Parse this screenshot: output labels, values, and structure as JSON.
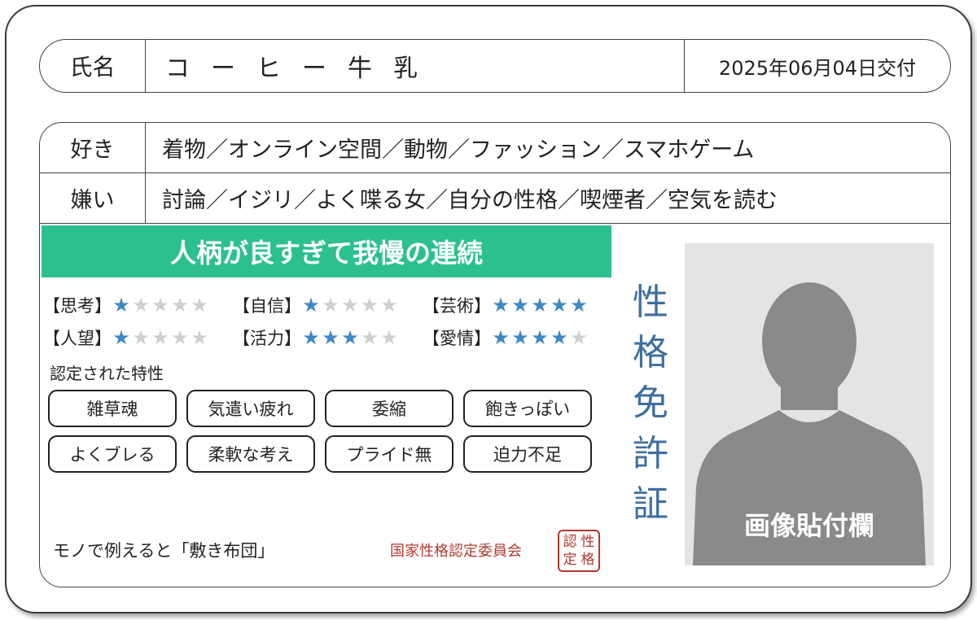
{
  "name_row": {
    "label": "氏名",
    "name": "コーヒー牛乳",
    "issued": "2025年06月04日交付"
  },
  "likes": {
    "label": "好き",
    "value": "着物／オンライン空間／動物／ファッション／スマホゲーム"
  },
  "dislikes": {
    "label": "嫌い",
    "value": "討論／イジリ／よく喋る女／自分の性格／喫煙者／空気を読む"
  },
  "headline": "人柄が良すぎて我慢の連続",
  "stats": [
    {
      "label": "【思考】",
      "stars": 1,
      "max": 5
    },
    {
      "label": "【自信】",
      "stars": 1,
      "max": 5
    },
    {
      "label": "【芸術】",
      "stars": 5,
      "max": 5
    },
    {
      "label": "【人望】",
      "stars": 1,
      "max": 5
    },
    {
      "label": "【活力】",
      "stars": 3,
      "max": 5
    },
    {
      "label": "【愛情】",
      "stars": 4,
      "max": 5
    }
  ],
  "traits_title": "認定された特性",
  "traits": [
    "雑草魂",
    "気遣い疲れ",
    "委縮",
    "飽きっぽい",
    "よくブレる",
    "柔軟な考え",
    "プライド無",
    "迫力不足"
  ],
  "vertical_title": [
    "性",
    "格",
    "免",
    "許",
    "証"
  ],
  "photo_label": "画像貼付欄",
  "analogy": "モノで例えると「敷き布団」",
  "committee": "国家性格認定委員会",
  "seal": [
    "認",
    "性",
    "定",
    "格"
  ],
  "colors": {
    "headline_bg": "#2dc08f",
    "star_on": "#3f88c5",
    "star_off": "#cfcfcf",
    "vertical_title": "#3d6f9e",
    "seal": "#b03a2e",
    "photo_bg": "#e4e4e4",
    "silhouette": "#8a8a8a"
  }
}
